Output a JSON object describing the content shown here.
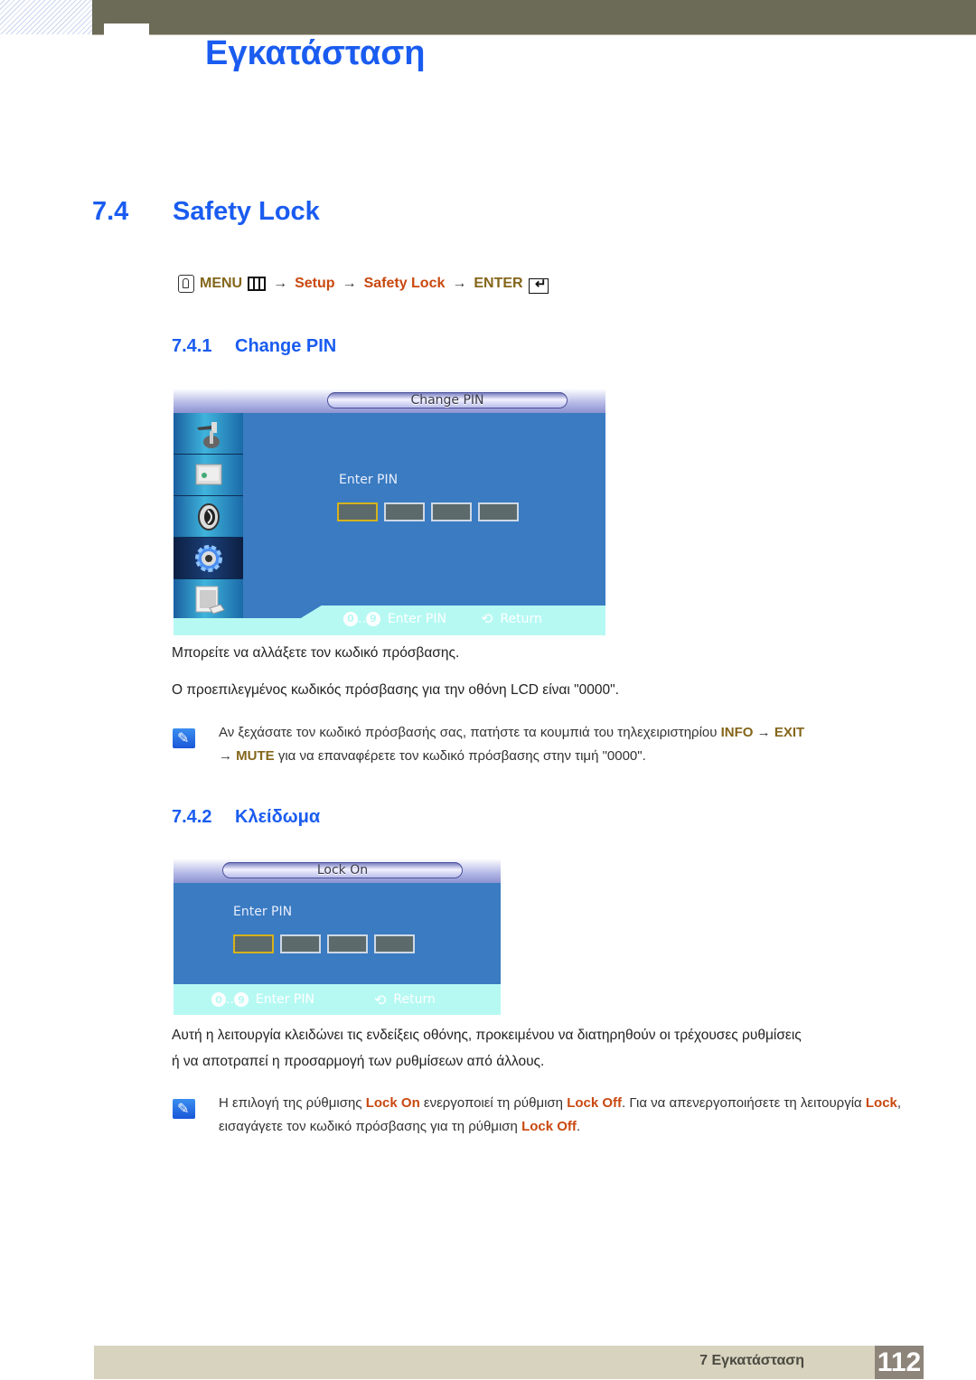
{
  "header": {
    "chapter_title": "Εγκατάσταση"
  },
  "section": {
    "number": "7.4",
    "title": "Safety Lock"
  },
  "menu_path": {
    "menu": "MENU",
    "arrow": "→",
    "setup": "Setup",
    "safety_lock": "Safety Lock",
    "enter": "ENTER"
  },
  "change_pin": {
    "number": "7.4.1",
    "title": "Change PIN",
    "osd": {
      "header": "Change PIN",
      "label": "Enter PIN",
      "footer_digits_from": "0",
      "footer_dots": "..",
      "footer_digits_to": "9",
      "footer_enter": "Enter PIN",
      "footer_return": "Return"
    },
    "para1": "Μπορείτε να αλλάξετε τον κωδικό πρόσβασης.",
    "para2": "Ο προεπιλεγμένος κωδικός πρόσβασης για την οθόνη LCD είναι \"0000\".",
    "note": {
      "t1": "Αν ξεχάσατε τον κωδικό πρόσβασής σας, πατήστε τα κουμπιά του τηλεχειριστηρίου ",
      "info": "INFO",
      "arrow": " → ",
      "exit": "EXIT",
      "mute": "MUTE",
      "t2": " για να επαναφέρετε τον κωδικό πρόσβασης στην τιμή \"0000\"."
    }
  },
  "lock": {
    "number": "7.4.2",
    "title": "Κλείδωμα",
    "osd": {
      "header": "Lock On",
      "label": "Enter PIN",
      "footer_digits_from": "0",
      "footer_dots": "..",
      "footer_digits_to": "9",
      "footer_enter": "Enter PIN",
      "footer_return": "Return"
    },
    "para1": "Αυτή η λειτουργία κλειδώνει τις ενδείξεις οθόνης, προκειμένου να διατηρηθούν οι τρέχουσες ρυθμίσεις",
    "para2": "ή να αποτραπεί η προσαρμογή των ρυθμίσεων από άλλους.",
    "note": {
      "t1": "Η επιλογή της ρύθμισης ",
      "lock_on": "Lock On",
      "t2": " ενεργοποιεί τη ρύθμιση ",
      "lock_off": "Lock Off",
      "t3": ". Για να απενεργοποιήσετε τη λειτουργία ",
      "lock": "Lock",
      "t4": ", εισαγάγετε τον κωδικό πρόσβασης για τη ρύθμιση ",
      "lock_off2": "Lock Off",
      "t5": "."
    }
  },
  "footer": {
    "chapter_label": "7 Εγκατάσταση",
    "page_number": "112"
  }
}
